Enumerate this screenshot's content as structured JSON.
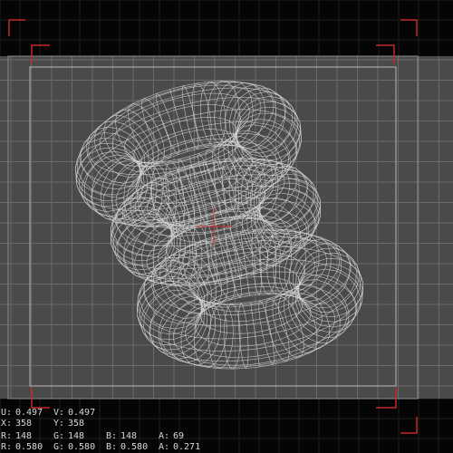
{
  "colors": {
    "background": "#050505",
    "grid_panel": "#4a4a4a",
    "grid_line": "#6a6a6a",
    "grid_outer_line": "#1e1e1e",
    "wireframe": "#d6d6d6",
    "crosshair": "#d22a2a",
    "corner_marks": "#c42828",
    "text": "#d8d8d8"
  },
  "pixel_readout": {
    "u_label": "U:",
    "u_value": "0.497",
    "v_label": "V:",
    "v_value": "0.497",
    "x_label": "X:",
    "x_value": "358",
    "y_label": "Y:",
    "y_value": "358",
    "r_label": "R:",
    "r_value": "148",
    "g_label": "G:",
    "g_value": "148",
    "b_label": "B:",
    "b_value": "148",
    "a_label": "A:",
    "a_value": "69",
    "rf_label": "R:",
    "rf_value": "0.580",
    "gf_label": "G:",
    "gf_value": "0.580",
    "bf_label": "B:",
    "bf_value": "0.580",
    "af_label": "A:",
    "af_value": "0.271"
  },
  "viewport": {
    "object": "wireframe-torus-chain",
    "torus_count": 3,
    "grid": true
  }
}
